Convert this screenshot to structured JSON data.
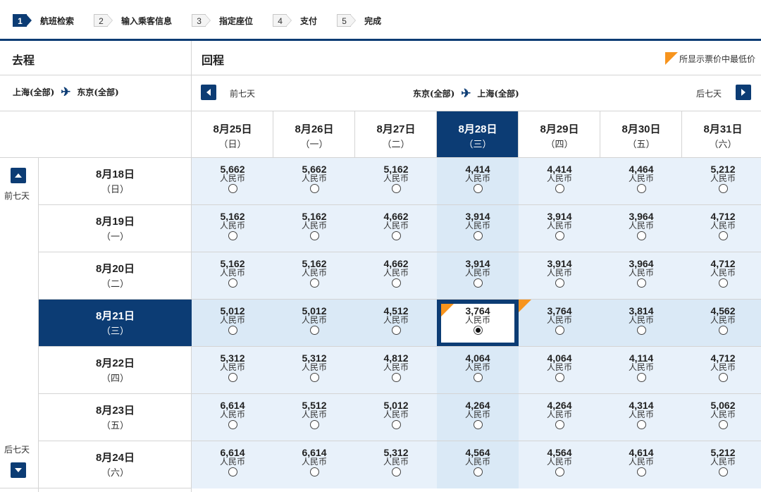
{
  "steps": [
    {
      "num": "1",
      "label": "航班检索",
      "active": true
    },
    {
      "num": "2",
      "label": "输入乘客信息",
      "active": false
    },
    {
      "num": "3",
      "label": "指定座位",
      "active": false
    },
    {
      "num": "4",
      "label": "支付",
      "active": false
    },
    {
      "num": "5",
      "label": "完成",
      "active": false
    }
  ],
  "outbound": {
    "title": "去程",
    "from": "上海(全部)",
    "to": "东京(全部)",
    "prev_label": "前七天",
    "next_label": "后七天"
  },
  "return": {
    "title": "回程",
    "from": "东京(全部)",
    "to": "上海(全部)",
    "prev_label": "前七天",
    "next_label": "后七天"
  },
  "legend": "所显示票价中最低价",
  "currency": "人民币",
  "return_dates": [
    {
      "date": "8月25日",
      "weekday": "（日）"
    },
    {
      "date": "8月26日",
      "weekday": "（一）"
    },
    {
      "date": "8月27日",
      "weekday": "（二）"
    },
    {
      "date": "8月28日",
      "weekday": "（三）"
    },
    {
      "date": "8月29日",
      "weekday": "（四）"
    },
    {
      "date": "8月30日",
      "weekday": "（五）"
    },
    {
      "date": "8月31日",
      "weekday": "（六）"
    }
  ],
  "outbound_dates": [
    {
      "date": "8月18日",
      "weekday": "（日）"
    },
    {
      "date": "8月19日",
      "weekday": "（一）"
    },
    {
      "date": "8月20日",
      "weekday": "（二）"
    },
    {
      "date": "8月21日",
      "weekday": "（三）"
    },
    {
      "date": "8月22日",
      "weekday": "（四）"
    },
    {
      "date": "8月23日",
      "weekday": "（五）"
    },
    {
      "date": "8月24日",
      "weekday": "（六）"
    }
  ],
  "selected_return_index": 3,
  "selected_outbound_index": 3,
  "prices": [
    [
      "5,662",
      "5,662",
      "5,162",
      "4,414",
      "4,414",
      "4,464",
      "5,212"
    ],
    [
      "5,162",
      "5,162",
      "4,662",
      "3,914",
      "3,914",
      "3,964",
      "4,712"
    ],
    [
      "5,162",
      "5,162",
      "4,662",
      "3,914",
      "3,914",
      "3,964",
      "4,712"
    ],
    [
      "5,012",
      "5,012",
      "4,512",
      "3,764",
      "3,764",
      "3,814",
      "4,562"
    ],
    [
      "5,312",
      "5,312",
      "4,812",
      "4,064",
      "4,064",
      "4,114",
      "4,712"
    ],
    [
      "6,614",
      "5,512",
      "5,012",
      "4,264",
      "4,264",
      "4,314",
      "5,062"
    ],
    [
      "6,614",
      "6,614",
      "5,312",
      "4,564",
      "4,564",
      "4,614",
      "5,212"
    ]
  ],
  "lowest_cells": [
    [
      3,
      3
    ],
    [
      3,
      4
    ]
  ],
  "colors": {
    "primary": "#0c3c74",
    "lowest": "#f7941d",
    "cell_bg": "#e8f1fa"
  }
}
